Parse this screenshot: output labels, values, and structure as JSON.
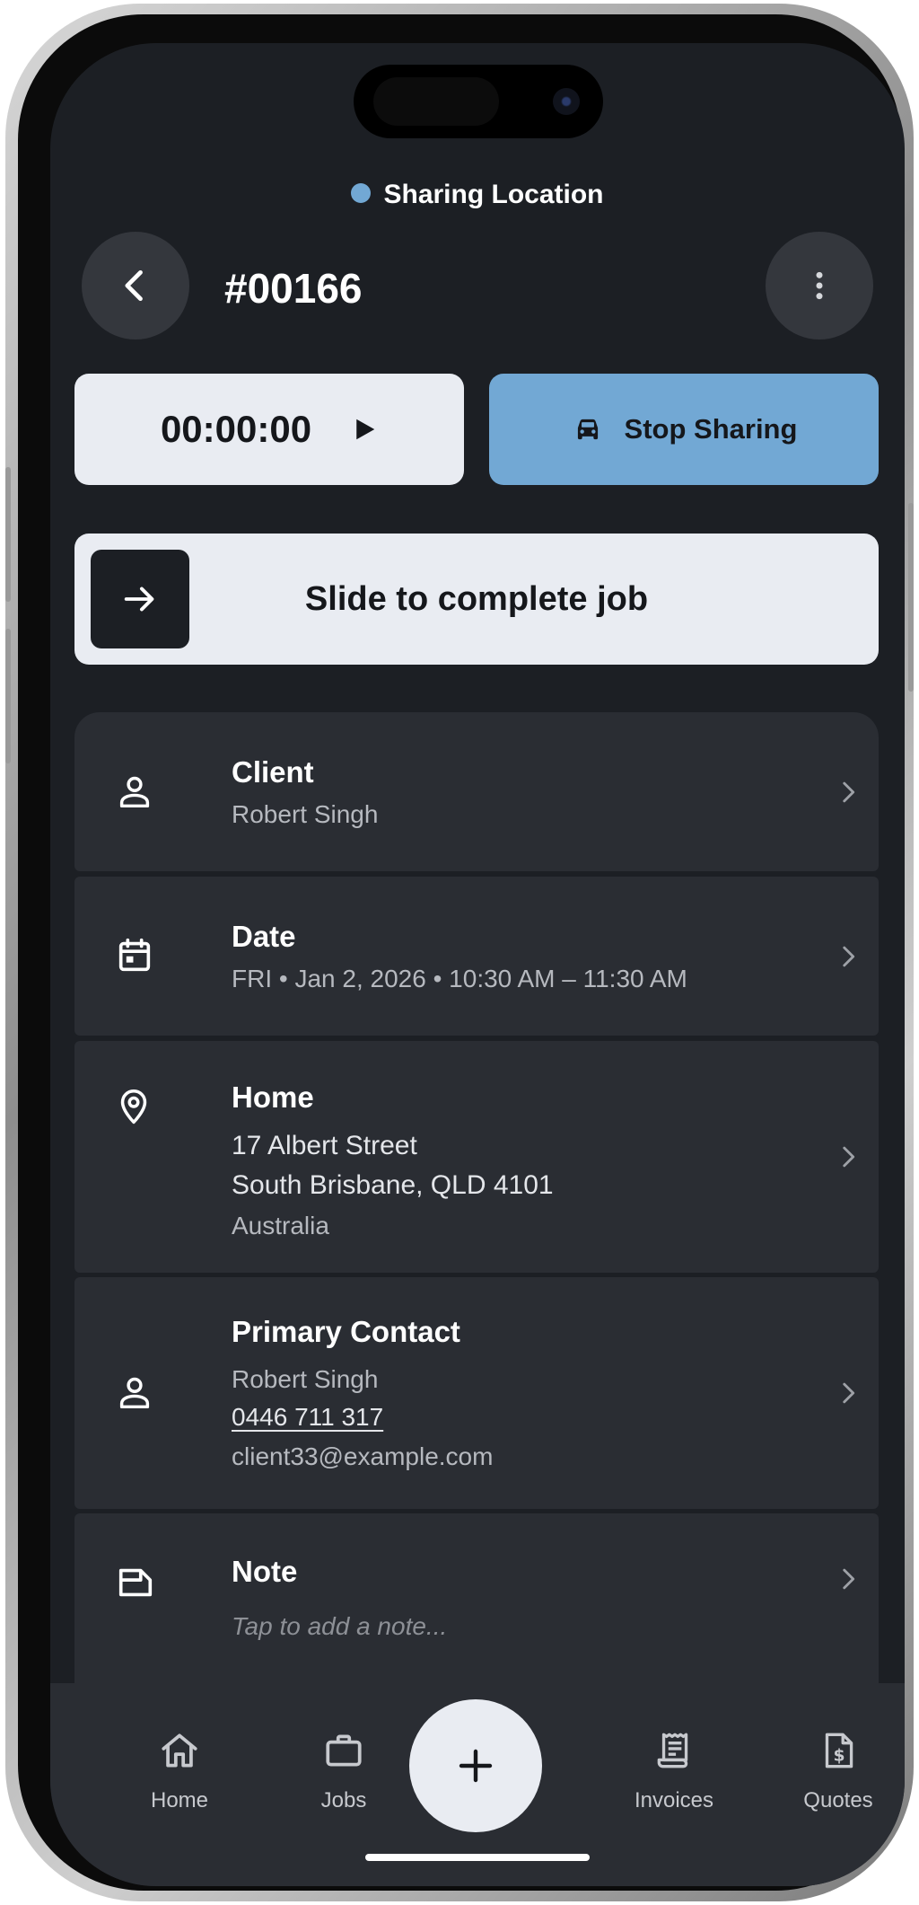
{
  "status": {
    "label": "Sharing Location",
    "dot_color": "#72a8d4"
  },
  "header": {
    "job_number": "#00166",
    "back_icon": "chevron-left-icon",
    "more_icon": "more-vertical-icon"
  },
  "timer": {
    "time": "00:00:00",
    "icon": "play-icon"
  },
  "sharing_button": {
    "label": "Stop Sharing",
    "icon": "car-icon",
    "color": "#72a8d4"
  },
  "slider": {
    "label": "Slide to complete job",
    "icon": "arrow-right-icon"
  },
  "cards": {
    "client": {
      "title": "Client",
      "name": "Robert Singh"
    },
    "date": {
      "title": "Date",
      "value": "FRI • Jan 2, 2026 • 10:30 AM – 11:30 AM"
    },
    "address": {
      "title": "Home",
      "line1": "17 Albert Street",
      "line2": "South Brisbane, QLD 4101",
      "country": "Australia"
    },
    "contact": {
      "title": "Primary Contact",
      "name": "Robert Singh",
      "phone": "0446 711 317",
      "email": "client33@example.com"
    },
    "note": {
      "title": "Note",
      "placeholder": "Tap to add a note..."
    }
  },
  "bottom_nav": {
    "items": [
      {
        "label": "Home",
        "icon": "home-icon"
      },
      {
        "label": "Jobs",
        "icon": "briefcase-icon"
      },
      {
        "label": "Invoices",
        "icon": "receipt-icon"
      },
      {
        "label": "Quotes",
        "icon": "quote-document-icon"
      }
    ],
    "fab_icon": "plus-icon"
  }
}
